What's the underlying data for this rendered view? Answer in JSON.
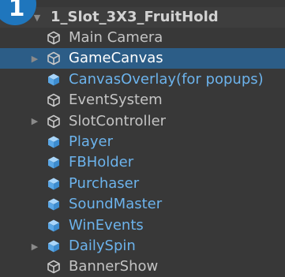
{
  "badge": {
    "number": "1"
  },
  "hierarchy": {
    "root": {
      "name": "1_Slot_3X3_FruitHold",
      "expanded": true
    },
    "items": [
      {
        "name": "Main Camera",
        "icon": "gameobject-icon",
        "prefab": false,
        "has_children": false,
        "selected": false
      },
      {
        "name": "GameCanvas",
        "icon": "gameobject-icon",
        "prefab": false,
        "has_children": true,
        "selected": true
      },
      {
        "name": "CanvasOverlay(for popups)",
        "icon": "prefab-icon",
        "prefab": true,
        "has_children": false,
        "selected": false
      },
      {
        "name": "EventSystem",
        "icon": "gameobject-icon",
        "prefab": false,
        "has_children": false,
        "selected": false
      },
      {
        "name": "SlotController",
        "icon": "gameobject-icon",
        "prefab": false,
        "has_children": true,
        "selected": false
      },
      {
        "name": "Player",
        "icon": "prefab-icon",
        "prefab": true,
        "has_children": false,
        "selected": false
      },
      {
        "name": "FBHolder",
        "icon": "prefab-icon",
        "prefab": true,
        "has_children": false,
        "selected": false
      },
      {
        "name": "Purchaser",
        "icon": "prefab-icon",
        "prefab": true,
        "has_children": false,
        "selected": false
      },
      {
        "name": "SoundMaster",
        "icon": "prefab-icon",
        "prefab": true,
        "has_children": false,
        "selected": false
      },
      {
        "name": "WinEvents",
        "icon": "prefab-icon",
        "prefab": true,
        "has_children": false,
        "selected": false
      },
      {
        "name": "DailySpin",
        "icon": "prefab-icon",
        "prefab": true,
        "has_children": true,
        "selected": false
      },
      {
        "name": "BannerShow",
        "icon": "gameobject-icon",
        "prefab": false,
        "has_children": false,
        "selected": false
      }
    ]
  },
  "colors": {
    "background": "#383838",
    "selection": "#2c5d87",
    "prefab_text": "#6cb3ec",
    "default_text": "#c4c4c4",
    "badge": "#1f76bd"
  }
}
